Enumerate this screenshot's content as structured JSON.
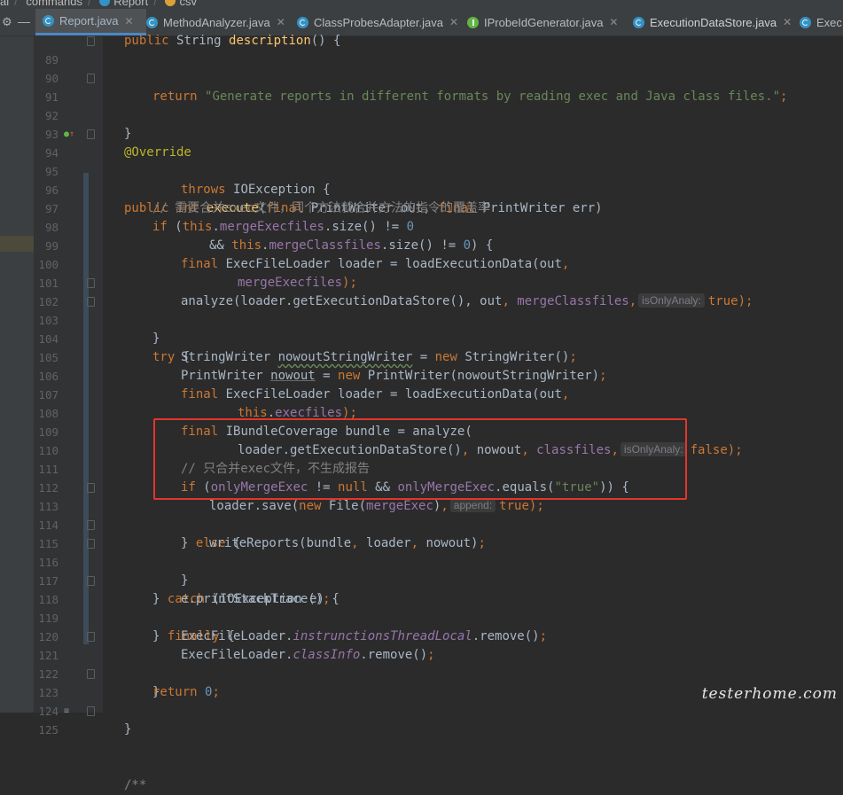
{
  "breadcrumb": {
    "items": [
      "al",
      "commands",
      "Report",
      "csv"
    ]
  },
  "tabs": [
    {
      "label": "Report.java",
      "icon": "class-icon",
      "active": true
    },
    {
      "label": "MethodAnalyzer.java",
      "icon": "class-icon"
    },
    {
      "label": "ClassProbesAdapter.java",
      "icon": "class-icon"
    },
    {
      "label": "IProbeIdGenerator.java",
      "icon": "interface-icon"
    },
    {
      "label": "ExecutionDataStore.java",
      "icon": "class-icon"
    },
    {
      "label": "Exec",
      "icon": "class-icon"
    }
  ],
  "editor": {
    "line_numbers": [
      "89",
      "90",
      "91",
      "92",
      "93",
      "94",
      "95",
      "96",
      "97",
      "98",
      "99",
      "100",
      "101",
      "102",
      "103",
      "104",
      "105",
      "106",
      "107",
      "108",
      "109",
      "110",
      "111",
      "112",
      "113",
      "114",
      "115",
      "116",
      "117",
      "118",
      "119",
      "120",
      "121",
      "122",
      "123",
      "124",
      "125"
    ],
    "lines": {
      "l89": [
        "public",
        "String",
        "description",
        "() {"
      ],
      "l90": [
        "return",
        "\"Generate reports in different formats by reading exec and Java class files.\"",
        ";"
      ],
      "l91": [
        "}"
      ],
      "l93": [
        "@Override"
      ],
      "l94": [
        "public",
        "int",
        "execute",
        "(",
        "final",
        "PrintWriter out, ",
        "final",
        "PrintWriter err)"
      ],
      "l95": [
        "throws",
        "IOException {"
      ],
      "l96": [
        "// 需要合并exec文件，同个方法就合并方法的指令的覆盖率"
      ],
      "l97": [
        "if",
        "(",
        "this",
        ".",
        "mergeExecfiles",
        ".size() != ",
        "0"
      ],
      "l98": [
        "&& ",
        "this",
        ".",
        "mergeClassfiles",
        ".size() != ",
        "0",
        ") {"
      ],
      "l99": [
        "final",
        "ExecFileLoader loader = loadExecutionData(out",
        ","
      ],
      "l100": [
        "mergeExecfiles",
        ");"
      ],
      "l101": [
        "analyze(loader.getExecutionDataStore(), out",
        ", ",
        "mergeClassfiles",
        ",",
        "isOnlyAnaly:",
        "true",
        ");"
      ],
      "l102": [
        "}"
      ],
      "l103": [
        "try",
        "{"
      ],
      "l104": [
        "StringWriter ",
        "nowoutStringWriter",
        " = ",
        "new",
        "StringWriter()",
        ";"
      ],
      "l105": [
        "PrintWriter ",
        "nowout",
        " = ",
        "new",
        "PrintWriter(nowoutStringWriter)",
        ";"
      ],
      "l106": [
        "final",
        "ExecFileLoader loader = loadExecutionData(out",
        ","
      ],
      "l107": [
        "this",
        ".",
        "execfiles",
        ");"
      ],
      "l108": [
        "final",
        "IBundleCoverage bundle = analyze("
      ],
      "l109": [
        "loader.getExecutionDataStore()",
        ", ",
        "nowout",
        ", ",
        "classfiles",
        ",",
        "isOnlyAnaly:",
        "false",
        ");"
      ],
      "l110": [
        "// 只合并exec文件，不生成报告"
      ],
      "l111": [
        "if",
        "(",
        "onlyMergeExec",
        " != ",
        "null",
        " && ",
        "onlyMergeExec",
        ".equals(",
        "\"true\"",
        ")) {"
      ],
      "l112": [
        "loader.save(",
        "new",
        "File(",
        "mergeExec",
        ")",
        ",",
        "append:",
        "true",
        ");"
      ],
      "l113": [
        "} ",
        "else",
        "{"
      ],
      "l114": [
        "writeReports(bundle",
        ", ",
        "loader",
        ", ",
        "nowout)",
        ";"
      ],
      "l115": [
        "}"
      ],
      "l116": [
        "} ",
        "catch",
        "(IOException e) {"
      ],
      "l117": [
        "e.printStackTrace()",
        ";"
      ],
      "l118": [
        "} ",
        "finally",
        "{"
      ],
      "l119": [
        "ExecFileLoader.",
        "instrunctionsThreadLocal",
        ".remove()",
        ";"
      ],
      "l120": [
        "ExecFileLoader.",
        "classInfo",
        ".remove()",
        ";"
      ],
      "l121": [
        "}"
      ],
      "l122": [
        "return",
        "0",
        ";"
      ],
      "l123": [
        "}"
      ],
      "l125": [
        "/**"
      ]
    }
  },
  "watermark": "testerhome.com",
  "colors": {
    "background": "#2b2b2b",
    "keyword": "#cc7832",
    "string": "#6a8759",
    "field": "#9876aa",
    "method": "#ffc66d",
    "comment": "#808080",
    "annotation": "#bbb529",
    "number": "#6897bb",
    "highlight_box": "#e3352c"
  }
}
